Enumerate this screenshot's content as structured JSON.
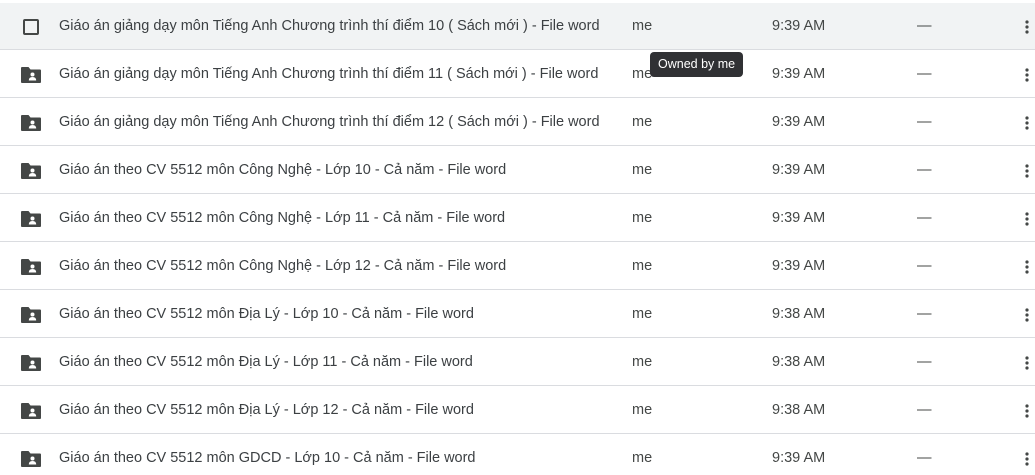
{
  "tooltip": {
    "text": "Owned by me"
  },
  "icons": {
    "folder": "shared-folder-icon",
    "checkbox": "checkbox-icon",
    "more": "more-vert-icon"
  },
  "colors": {
    "icon": "#444746",
    "hover_row": "#f1f3f4",
    "tooltip_bg": "#303134",
    "divider": "#dadce0"
  },
  "files": [
    {
      "name": "Giáo án giảng dạy môn Tiếng Anh Chương trình thí điểm 10 ( Sách mới ) - File word",
      "owner": "me",
      "modified": "9:39 AM",
      "size": "—"
    },
    {
      "name": "Giáo án giảng dạy môn Tiếng Anh Chương trình thí điểm 11 ( Sách mới ) - File word",
      "owner": "me",
      "modified": "9:39 AM",
      "size": "—"
    },
    {
      "name": "Giáo án giảng dạy môn Tiếng Anh Chương trình thí điểm 12 ( Sách mới ) - File word",
      "owner": "me",
      "modified": "9:39 AM",
      "size": "—"
    },
    {
      "name": "Giáo án theo CV 5512 môn Công Nghệ - Lớp 10 - Cả năm - File word",
      "owner": "me",
      "modified": "9:39 AM",
      "size": "—"
    },
    {
      "name": "Giáo án theo CV 5512 môn Công Nghệ - Lớp 11 - Cả năm - File word",
      "owner": "me",
      "modified": "9:39 AM",
      "size": "—"
    },
    {
      "name": "Giáo án theo CV 5512 môn Công Nghệ - Lớp 12 - Cả năm - File word",
      "owner": "me",
      "modified": "9:39 AM",
      "size": "—"
    },
    {
      "name": "Giáo án theo CV 5512 môn Địa Lý - Lớp 10 - Cả năm - File word",
      "owner": "me",
      "modified": "9:38 AM",
      "size": "—"
    },
    {
      "name": "Giáo án theo CV 5512 môn Địa Lý - Lớp 11 - Cả năm - File word",
      "owner": "me",
      "modified": "9:38 AM",
      "size": "—"
    },
    {
      "name": "Giáo án theo CV 5512 môn Địa Lý - Lớp 12 - Cả năm - File word",
      "owner": "me",
      "modified": "9:38 AM",
      "size": "—"
    },
    {
      "name": "Giáo án theo CV 5512 môn GDCD - Lớp 10 - Cả năm - File word",
      "owner": "me",
      "modified": "9:39 AM",
      "size": "—"
    }
  ]
}
